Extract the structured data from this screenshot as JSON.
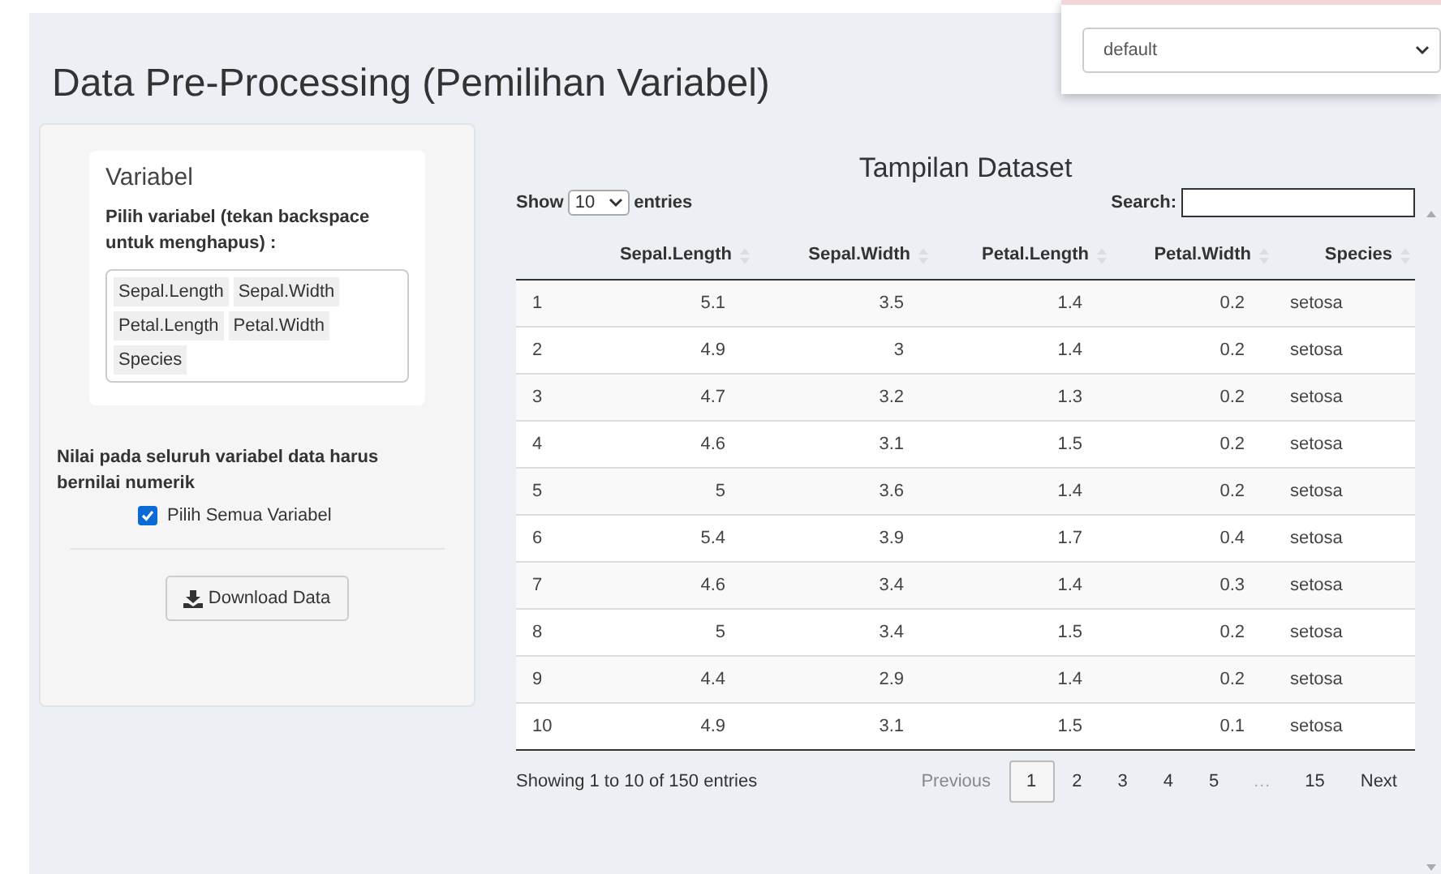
{
  "title": "Data Pre-Processing (Pemilihan Variabel)",
  "dropdown": {
    "value": "default"
  },
  "variable_panel": {
    "title": "Variabel",
    "select_label": "Pilih variabel (tekan backspace untuk menghapus) :",
    "tags": [
      "Sepal.Length",
      "Sepal.Width",
      "Petal.Length",
      "Petal.Width",
      "Species"
    ],
    "note": "Nilai pada seluruh variabel data harus bernilai numerik",
    "select_all": {
      "label": "Pilih Semua Variabel",
      "checked": true
    },
    "download_button": "Download Data"
  },
  "table": {
    "title": "Tampilan Dataset",
    "show_label": "Show",
    "length_value": "10",
    "entries_label": "entries",
    "search_label": "Search:",
    "columns": [
      "",
      "Sepal.Length",
      "Sepal.Width",
      "Petal.Length",
      "Petal.Width",
      "Species"
    ],
    "rows": [
      [
        "1",
        "5.1",
        "3.5",
        "1.4",
        "0.2",
        "setosa"
      ],
      [
        "2",
        "4.9",
        "3",
        "1.4",
        "0.2",
        "setosa"
      ],
      [
        "3",
        "4.7",
        "3.2",
        "1.3",
        "0.2",
        "setosa"
      ],
      [
        "4",
        "4.6",
        "3.1",
        "1.5",
        "0.2",
        "setosa"
      ],
      [
        "5",
        "5",
        "3.6",
        "1.4",
        "0.2",
        "setosa"
      ],
      [
        "6",
        "5.4",
        "3.9",
        "1.7",
        "0.4",
        "setosa"
      ],
      [
        "7",
        "4.6",
        "3.4",
        "1.4",
        "0.3",
        "setosa"
      ],
      [
        "8",
        "5",
        "3.4",
        "1.5",
        "0.2",
        "setosa"
      ],
      [
        "9",
        "4.4",
        "2.9",
        "1.4",
        "0.2",
        "setosa"
      ],
      [
        "10",
        "4.9",
        "3.1",
        "1.5",
        "0.1",
        "setosa"
      ]
    ],
    "info": "Showing 1 to 10 of 150 entries",
    "pagination": [
      {
        "label": "Previous",
        "kind": "link",
        "selected": false,
        "disabled": true
      },
      {
        "label": "1",
        "kind": "link",
        "selected": true,
        "disabled": false
      },
      {
        "label": "2",
        "kind": "link",
        "selected": false,
        "disabled": false
      },
      {
        "label": "3",
        "kind": "link",
        "selected": false,
        "disabled": false
      },
      {
        "label": "4",
        "kind": "link",
        "selected": false,
        "disabled": false
      },
      {
        "label": "5",
        "kind": "link",
        "selected": false,
        "disabled": false
      },
      {
        "label": "…",
        "kind": "ellipsis"
      },
      {
        "label": "15",
        "kind": "link",
        "selected": false,
        "disabled": false
      },
      {
        "label": "Next",
        "kind": "link",
        "selected": false,
        "disabled": false
      }
    ]
  }
}
